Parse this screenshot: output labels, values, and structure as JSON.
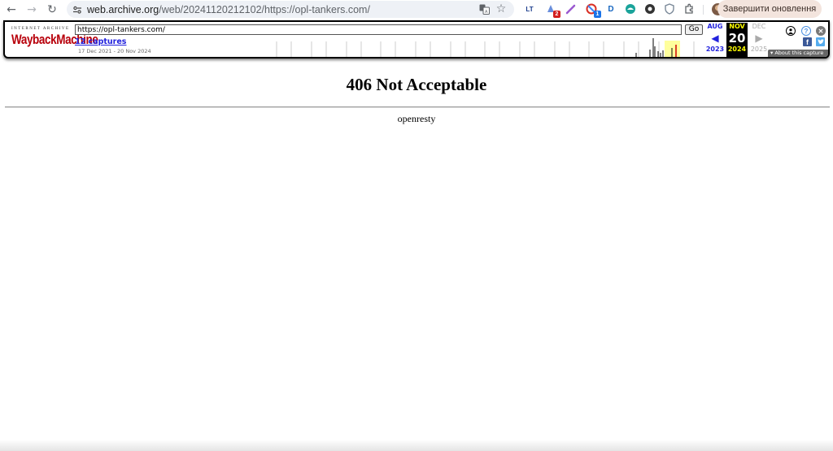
{
  "browser": {
    "url_host": "web.archive.org",
    "url_path": "/web/20241120212102/https://opl-tankers.com/",
    "update_button": "Завершити оновлення",
    "extension_badges": [
      "2",
      "1"
    ]
  },
  "wayback": {
    "logo_top": "INTERNET ARCHIVE",
    "logo_main": "WaybackMachine",
    "url_input": "https://opl-tankers.com/",
    "go_label": "Go",
    "captures": "12 captures",
    "date_range": "17 Dec 2021 - 20 Nov 2024",
    "calendar": {
      "prev": {
        "month": "AUG",
        "year": "2023"
      },
      "current": {
        "month": "NOV",
        "day": "20",
        "year": "2024"
      },
      "next": {
        "month": "DEC",
        "year": "2025"
      }
    },
    "about_capture": "About this capture"
  },
  "page": {
    "title": "406 Not Acceptable",
    "server": "openresty"
  },
  "colors": {
    "wayback_red": "#b8000b",
    "link_blue": "#2222dd",
    "current_bg": "#000000",
    "current_fg": "#ffff00"
  }
}
